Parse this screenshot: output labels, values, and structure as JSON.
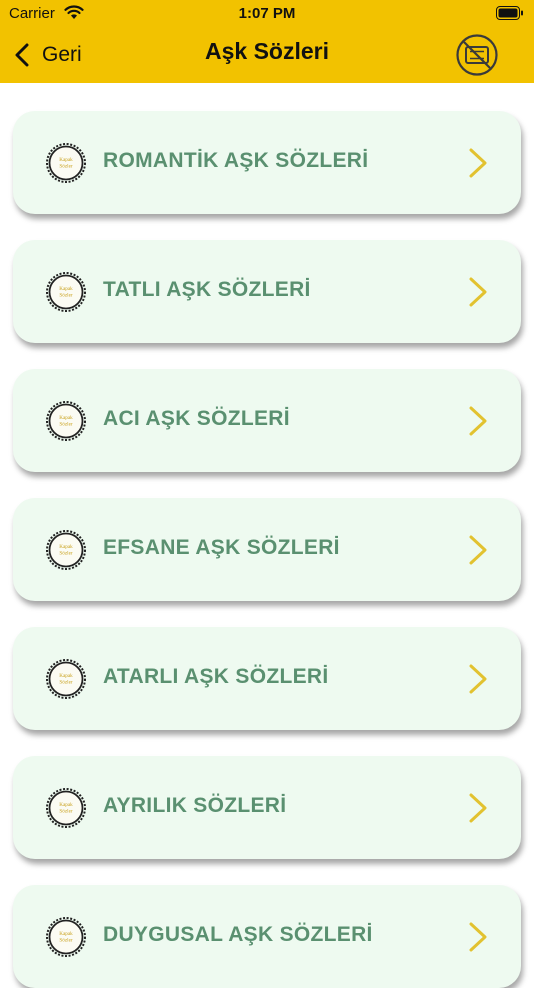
{
  "status_bar": {
    "carrier": "Carrier",
    "time": "1:07 PM"
  },
  "nav": {
    "back_label": "Geri",
    "title": "Aşk Sözleri"
  },
  "colors": {
    "bar": "#f2c200",
    "card_bg": "#eefaf0",
    "label": "#5a9070",
    "chevron": "#e2c230"
  },
  "badge_text": [
    "Kapak",
    "Sözler"
  ],
  "categories": [
    {
      "label": "ROMANTİK AŞK SÖZLERİ"
    },
    {
      "label": "TATLI AŞK SÖZLERİ"
    },
    {
      "label": "ACI AŞK SÖZLERİ"
    },
    {
      "label": "EFSANE AŞK SÖZLERİ"
    },
    {
      "label": "ATARLI AŞK SÖZLERİ"
    },
    {
      "label": "AYRILIK SÖZLERİ"
    },
    {
      "label": "DUYGUSAL AŞK SÖZLERİ"
    }
  ]
}
